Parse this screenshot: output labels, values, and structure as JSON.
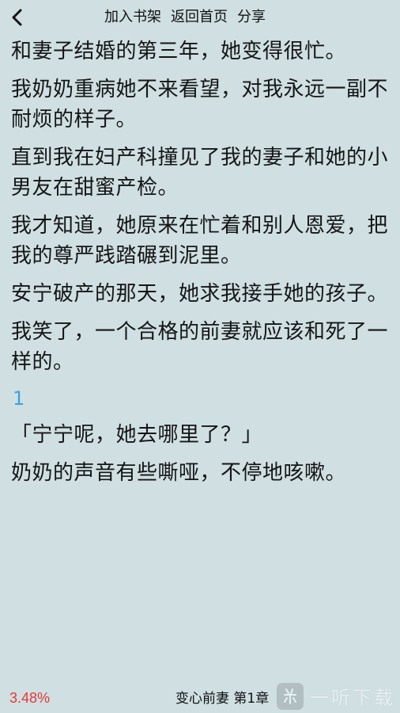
{
  "header": {
    "back_icon": "chevron-left-icon",
    "actions": [
      "加入书架",
      "返回首页",
      "分享"
    ]
  },
  "content": {
    "paragraphs": [
      "和妻子结婚的第三年，她变得很忙。",
      "我奶奶重病她不来看望，对我永远一副不耐烦的样子。",
      "直到我在妇产科撞见了我的妻子和她的小男友在甜蜜产检。",
      "我才知道，她原来在忙着和别人恩爱，把我的尊严践踏碾到泥里。",
      "安宁破产的那天，她求我接手她的孩子。",
      "我笑了，一个合格的前妻就应该和死了一样的。"
    ],
    "chapter_number": "1",
    "paragraphs_after": [
      "「宁宁呢，她去哪里了？」",
      "奶奶的声音有些嘶哑，不停地咳嗽。"
    ]
  },
  "footer": {
    "progress": "3.48%",
    "book_chapter": "变心前妻 第1章",
    "watermark_text": "一听下载"
  },
  "colors": {
    "background": "#cfdfe2",
    "progress": "#e53935",
    "chapter_number": "#3aa3d8"
  }
}
